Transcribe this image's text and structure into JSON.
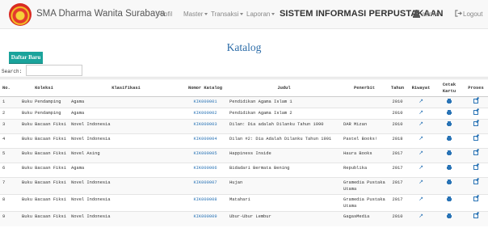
{
  "navbar": {
    "brand": "SMA Dharma Wanita Surabaya",
    "profil": "Profil",
    "master": "Master",
    "transaksi": "Transaksi",
    "laporan": "Laporan",
    "system_title": "SISTEM INFORMASI PERPUSTAKAAN",
    "user": "admin",
    "logout": "Logout"
  },
  "page": {
    "title": "Katalog",
    "add_button": "Daftar Baru",
    "search_label": "Search:",
    "search_value": ""
  },
  "table": {
    "headers": {
      "no": "No.",
      "koleksi": "Koleksi",
      "klasifikasi": "Klasifikasi",
      "nomor_katalog": "Nomor Katalog",
      "judul": "Judul",
      "penerbit": "Penerbit",
      "tahun": "Tahun",
      "riwayat": "Riwayat",
      "cetak_kartu": "Cetak Kartu",
      "proses": "Proses"
    },
    "icons": {
      "riwayat": "pin-icon",
      "cetak": "print-icon",
      "proses": "edit-icon"
    },
    "rows": [
      {
        "no": "1",
        "koleksi": "Buku Pendamping",
        "klasifikasi": "Agama",
        "nomor": "KIK000001",
        "judul": "Pendidikan Agama Islam 1",
        "penerbit": "",
        "tahun": "2010"
      },
      {
        "no": "2",
        "koleksi": "Buku Pendamping",
        "klasifikasi": "Agama",
        "nomor": "KIK000002",
        "judul": "Pendidikan Agama Islam 2",
        "penerbit": "",
        "tahun": "2010"
      },
      {
        "no": "3",
        "koleksi": "Buku Bacaan Fiksi",
        "klasifikasi": "Novel Indonesia",
        "nomor": "KIK000003",
        "judul": "Dilan: Dia adalah Dilanku Tahun 1990",
        "penerbit": "DAR Mizan",
        "tahun": "2010"
      },
      {
        "no": "4",
        "koleksi": "Buku Bacaan Fiksi",
        "klasifikasi": "Novel Indonesia",
        "nomor": "KIK000004",
        "judul": "Dilan #2: Dia Adalah Dilanku Tahun 1991",
        "penerbit": "Pastel Books!",
        "tahun": "2018"
      },
      {
        "no": "5",
        "koleksi": "Buku Bacaan Fiksi",
        "klasifikasi": "Novel Asing",
        "nomor": "KIK000005",
        "judul": "Happiness Inside",
        "penerbit": "Haura Books",
        "tahun": "2017"
      },
      {
        "no": "6",
        "koleksi": "Buku Bacaan Fiksi",
        "klasifikasi": "Agama",
        "nomor": "KIK000006",
        "judul": "Bidadari Bermata Bening",
        "penerbit": "Republika",
        "tahun": "2017"
      },
      {
        "no": "7",
        "koleksi": "Buku Bacaan Fiksi",
        "klasifikasi": "Novel Indonesia",
        "nomor": "KIK000007",
        "judul": "Hujan",
        "penerbit": "Gramedia Pustaka Utama",
        "tahun": "2017"
      },
      {
        "no": "8",
        "koleksi": "Buku Bacaan Fiksi",
        "klasifikasi": "Novel Indonesia",
        "nomor": "KIK000008",
        "judul": "Matahari",
        "penerbit": "Gramedia Pustaka Utama",
        "tahun": "2017"
      },
      {
        "no": "9",
        "koleksi": "Buku Bacaan Fiksi",
        "klasifikasi": "Novel Indonesia",
        "nomor": "KIK000009",
        "judul": "Ubur-Ubur Lembur",
        "penerbit": "GagasMedia",
        "tahun": "2010"
      }
    ]
  }
}
